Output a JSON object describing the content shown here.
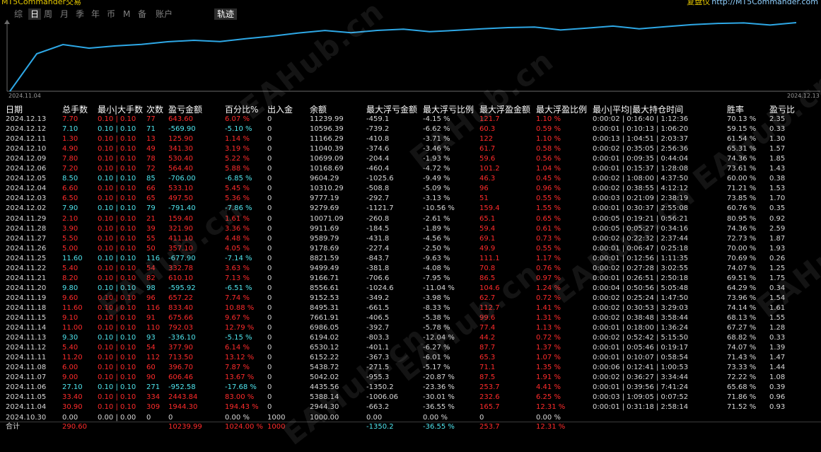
{
  "topbar": {
    "brand": "MT5Commander交易",
    "right_label": "复盘仪",
    "right_url": "http://MT5Commander.com"
  },
  "tabs": [
    "综",
    "日",
    "周",
    "月",
    "季",
    "年",
    "币",
    "M",
    "备",
    "账户"
  ],
  "active_tab": "日",
  "track_tab": "轨迹",
  "chart": {
    "start_date": "2024.11.04",
    "end_date": "2024.12.13",
    "line_color": "#2ea8e6",
    "balance_series": [
      1000.0,
      2944.3,
      5388.14,
      4435.56,
      5042.02,
      5438.72,
      6152.22,
      6530.12,
      6194.02,
      6986.05,
      7661.91,
      8495.31,
      9152.53,
      8556.61,
      9166.71,
      9499.49,
      8821.59,
      9178.69,
      9589.79,
      9911.69,
      10071.09,
      9279.69,
      9777.19,
      10310.29,
      9604.29,
      10168.69,
      10699.09,
      11040.39,
      11166.29,
      10596.39,
      11239.99
    ]
  },
  "columns": [
    "日期",
    "总手数",
    "最小|大手数",
    "次数",
    "盈亏金额",
    "百分比%",
    "出入金",
    "余额",
    "最大浮亏金额",
    "最大浮亏比例",
    "最大浮盈金额",
    "最大浮盈比例",
    "最小|平均|最大持仓时间",
    "胜率",
    "盈亏比"
  ],
  "rows": [
    {
      "c": "red",
      "date": "2024.12.13",
      "lots": "7.70",
      "minmax": "0.10 | 0.10",
      "count": "77",
      "pnl": "643.60",
      "pct": "6.07 %",
      "io": "0",
      "bal": "11239.99",
      "mdd": "-459.1",
      "mddp": "-4.15 %",
      "mfe": "121.7",
      "mfep": "1.10 %",
      "hold": "0:00:02 | 0:16:40 | 1:12:36",
      "win": "70.13 %",
      "pf": "2.35"
    },
    {
      "c": "cyan",
      "date": "2024.12.12",
      "lots": "7.10",
      "minmax": "0.10 | 0.10",
      "count": "71",
      "pnl": "-569.90",
      "pct": "-5.10 %",
      "io": "0",
      "bal": "10596.39",
      "mdd": "-739.2",
      "mddp": "-6.62 %",
      "mfe": "60.3",
      "mfep": "0.59 %",
      "hold": "0:00:01 | 0:10:13 | 1:06:20",
      "win": "59.15 %",
      "pf": "0.33"
    },
    {
      "c": "red",
      "date": "2024.12.11",
      "lots": "1.30",
      "minmax": "0.10 | 0.10",
      "count": "13",
      "pnl": "125.90",
      "pct": "1.14 %",
      "io": "0",
      "bal": "11166.29",
      "mdd": "-410.8",
      "mddp": "-3.71 %",
      "mfe": "122",
      "mfep": "1.10 %",
      "hold": "0:00:13 | 1:04:51 | 2:03:37",
      "win": "61.54 %",
      "pf": "1.30"
    },
    {
      "c": "red",
      "date": "2024.12.10",
      "lots": "4.90",
      "minmax": "0.10 | 0.10",
      "count": "49",
      "pnl": "341.30",
      "pct": "3.19 %",
      "io": "0",
      "bal": "11040.39",
      "mdd": "-374.6",
      "mddp": "-3.46 %",
      "mfe": "61.7",
      "mfep": "0.58 %",
      "hold": "0:00:02 | 0:35:05 | 2:56:36",
      "win": "65.31 %",
      "pf": "1.57"
    },
    {
      "c": "red",
      "date": "2024.12.09",
      "lots": "7.80",
      "minmax": "0.10 | 0.10",
      "count": "78",
      "pnl": "530.40",
      "pct": "5.22 %",
      "io": "0",
      "bal": "10699.09",
      "mdd": "-204.4",
      "mddp": "-1.93 %",
      "mfe": "59.6",
      "mfep": "0.56 %",
      "hold": "0:00:01 | 0:09:35 | 0:44:04",
      "win": "74.36 %",
      "pf": "1.85"
    },
    {
      "c": "red",
      "date": "2024.12.06",
      "lots": "7.20",
      "minmax": "0.10 | 0.10",
      "count": "72",
      "pnl": "564.40",
      "pct": "5.88 %",
      "io": "0",
      "bal": "10168.69",
      "mdd": "-460.4",
      "mddp": "-4.72 %",
      "mfe": "101.2",
      "mfep": "1.04 %",
      "hold": "0:00:01 | 0:15:37 | 1:28:08",
      "win": "73.61 %",
      "pf": "1.43"
    },
    {
      "c": "cyan",
      "date": "2024.12.05",
      "lots": "8.50",
      "minmax": "0.10 | 0.10",
      "count": "85",
      "pnl": "-706.00",
      "pct": "-6.85 %",
      "io": "0",
      "bal": "9604.29",
      "mdd": "-1025.6",
      "mddp": "-9.49 %",
      "mfe": "46.3",
      "mfep": "0.45 %",
      "hold": "0:00:02 | 1:08:00 | 4:37:50",
      "win": "60.00 %",
      "pf": "0.38"
    },
    {
      "c": "red",
      "date": "2024.12.04",
      "lots": "6.60",
      "minmax": "0.10 | 0.10",
      "count": "66",
      "pnl": "533.10",
      "pct": "5.45 %",
      "io": "0",
      "bal": "10310.29",
      "mdd": "-508.8",
      "mddp": "-5.09 %",
      "mfe": "96",
      "mfep": "0.96 %",
      "hold": "0:00:02 | 0:38:55 | 4:12:12",
      "win": "71.21 %",
      "pf": "1.53"
    },
    {
      "c": "red",
      "date": "2024.12.03",
      "lots": "6.50",
      "minmax": "0.10 | 0.10",
      "count": "65",
      "pnl": "497.50",
      "pct": "5.36 %",
      "io": "0",
      "bal": "9777.19",
      "mdd": "-292.7",
      "mddp": "-3.13 %",
      "mfe": "51",
      "mfep": "0.55 %",
      "hold": "0:00:03 | 0:21:09 | 2:38:19",
      "win": "73.85 %",
      "pf": "1.70"
    },
    {
      "c": "cyan",
      "date": "2024.12.02",
      "lots": "7.90",
      "minmax": "0.10 | 0.10",
      "count": "79",
      "pnl": "-791.40",
      "pct": "-7.86 %",
      "io": "0",
      "bal": "9279.69",
      "mdd": "-1121.7",
      "mddp": "-10.56 %",
      "mfe": "159.4",
      "mfep": "1.55 %",
      "hold": "0:00:01 | 0:30:37 | 2:55:08",
      "win": "60.76 %",
      "pf": "0.35"
    },
    {
      "c": "red",
      "date": "2024.11.29",
      "lots": "2.10",
      "minmax": "0.10 | 0.10",
      "count": "21",
      "pnl": "159.40",
      "pct": "1.61 %",
      "io": "0",
      "bal": "10071.09",
      "mdd": "-260.8",
      "mddp": "-2.61 %",
      "mfe": "65.1",
      "mfep": "0.65 %",
      "hold": "0:00:05 | 0:19:21 | 0:56:21",
      "win": "80.95 %",
      "pf": "0.92"
    },
    {
      "c": "red",
      "date": "2024.11.28",
      "lots": "3.90",
      "minmax": "0.10 | 0.10",
      "count": "39",
      "pnl": "321.90",
      "pct": "3.36 %",
      "io": "0",
      "bal": "9911.69",
      "mdd": "-184.5",
      "mddp": "-1.89 %",
      "mfe": "59.4",
      "mfep": "0.61 %",
      "hold": "0:00:05 | 0:05:27 | 0:34:16",
      "win": "74.36 %",
      "pf": "2.59"
    },
    {
      "c": "red",
      "date": "2024.11.27",
      "lots": "5.50",
      "minmax": "0.10 | 0.10",
      "count": "55",
      "pnl": "411.10",
      "pct": "4.48 %",
      "io": "0",
      "bal": "9589.79",
      "mdd": "-431.8",
      "mddp": "-4.56 %",
      "mfe": "69.1",
      "mfep": "0.73 %",
      "hold": "0:00:02 | 0:22:32 | 2:37:44",
      "win": "72.73 %",
      "pf": "1.87"
    },
    {
      "c": "red",
      "date": "2024.11.26",
      "lots": "5.00",
      "minmax": "0.10 | 0.10",
      "count": "50",
      "pnl": "357.10",
      "pct": "4.05 %",
      "io": "0",
      "bal": "9178.69",
      "mdd": "-227.4",
      "mddp": "-2.50 %",
      "mfe": "49.9",
      "mfep": "0.55 %",
      "hold": "0:00:01 | 0:06:47 | 0:25:18",
      "win": "70.00 %",
      "pf": "1.93"
    },
    {
      "c": "cyan",
      "date": "2024.11.25",
      "lots": "11.60",
      "minmax": "0.10 | 0.10",
      "count": "116",
      "pnl": "-677.90",
      "pct": "-7.14 %",
      "io": "0",
      "bal": "8821.59",
      "mdd": "-843.7",
      "mddp": "-9.63 %",
      "mfe": "111.1",
      "mfep": "1.17 %",
      "hold": "0:00:01 | 0:12:56 | 1:11:35",
      "win": "70.69 %",
      "pf": "0.26"
    },
    {
      "c": "red",
      "date": "2024.11.22",
      "lots": "5.40",
      "minmax": "0.10 | 0.10",
      "count": "54",
      "pnl": "332.78",
      "pct": "3.63 %",
      "io": "0",
      "bal": "9499.49",
      "mdd": "-381.8",
      "mddp": "-4.08 %",
      "mfe": "70.8",
      "mfep": "0.76 %",
      "hold": "0:00:02 | 0:27:28 | 3:02:55",
      "win": "74.07 %",
      "pf": "1.25"
    },
    {
      "c": "red",
      "date": "2024.11.21",
      "lots": "8.20",
      "minmax": "0.10 | 0.10",
      "count": "82",
      "pnl": "610.10",
      "pct": "7.13 %",
      "io": "0",
      "bal": "9166.71",
      "mdd": "-706.6",
      "mddp": "-7.95 %",
      "mfe": "86.5",
      "mfep": "0.97 %",
      "hold": "0:00:01 | 0:26:51 | 2:50:18",
      "win": "69.51 %",
      "pf": "1.75"
    },
    {
      "c": "cyan",
      "date": "2024.11.20",
      "lots": "9.80",
      "minmax": "0.10 | 0.10",
      "count": "98",
      "pnl": "-595.92",
      "pct": "-6.51 %",
      "io": "0",
      "bal": "8556.61",
      "mdd": "-1024.6",
      "mddp": "-11.04 %",
      "mfe": "104.6",
      "mfep": "1.24 %",
      "hold": "0:00:04 | 0:50:56 | 5:05:48",
      "win": "64.29 %",
      "pf": "0.34"
    },
    {
      "c": "red",
      "date": "2024.11.19",
      "lots": "9.60",
      "minmax": "0.10 | 0.10",
      "count": "96",
      "pnl": "657.22",
      "pct": "7.74 %",
      "io": "0",
      "bal": "9152.53",
      "mdd": "-349.2",
      "mddp": "-3.98 %",
      "mfe": "62.7",
      "mfep": "0.72 %",
      "hold": "0:00:02 | 0:25:24 | 1:47:50",
      "win": "73.96 %",
      "pf": "1.54"
    },
    {
      "c": "red",
      "date": "2024.11.18",
      "lots": "11.60",
      "minmax": "0.10 | 0.10",
      "count": "116",
      "pnl": "833.40",
      "pct": "10.88 %",
      "io": "0",
      "bal": "8495.31",
      "mdd": "-661.5",
      "mddp": "-8.33 %",
      "mfe": "112.7",
      "mfep": "1.41 %",
      "hold": "0:00:02 | 0:30:53 | 3:29:03",
      "win": "74.14 %",
      "pf": "1.61"
    },
    {
      "c": "red",
      "date": "2024.11.15",
      "lots": "9.10",
      "minmax": "0.10 | 0.10",
      "count": "91",
      "pnl": "675.66",
      "pct": "9.67 %",
      "io": "0",
      "bal": "7661.91",
      "mdd": "-406.5",
      "mddp": "-5.38 %",
      "mfe": "99.6",
      "mfep": "1.31 %",
      "hold": "0:00:02 | 0:38:48 | 3:58:44",
      "win": "68.13 %",
      "pf": "1.55"
    },
    {
      "c": "red",
      "date": "2024.11.14",
      "lots": "11.00",
      "minmax": "0.10 | 0.10",
      "count": "110",
      "pnl": "792.03",
      "pct": "12.79 %",
      "io": "0",
      "bal": "6986.05",
      "mdd": "-392.7",
      "mddp": "-5.78 %",
      "mfe": "77.4",
      "mfep": "1.13 %",
      "hold": "0:00:01 | 0:18:00 | 1:36:24",
      "win": "67.27 %",
      "pf": "1.28"
    },
    {
      "c": "cyan",
      "date": "2024.11.13",
      "lots": "9.30",
      "minmax": "0.10 | 0.10",
      "count": "93",
      "pnl": "-336.10",
      "pct": "-5.15 %",
      "io": "0",
      "bal": "6194.02",
      "mdd": "-803.3",
      "mddp": "-12.04 %",
      "mfe": "44.2",
      "mfep": "0.72 %",
      "hold": "0:00:02 | 0:52:42 | 5:15:50",
      "win": "68.82 %",
      "pf": "0.33"
    },
    {
      "c": "red",
      "date": "2024.11.12",
      "lots": "5.40",
      "minmax": "0.10 | 0.10",
      "count": "54",
      "pnl": "377.90",
      "pct": "6.14 %",
      "io": "0",
      "bal": "6530.12",
      "mdd": "-401.1",
      "mddp": "-6.27 %",
      "mfe": "87.7",
      "mfep": "1.37 %",
      "hold": "0:00:01 | 0:05:46 | 0:19:17",
      "win": "74.07 %",
      "pf": "1.39"
    },
    {
      "c": "red",
      "date": "2024.11.11",
      "lots": "11.20",
      "minmax": "0.10 | 0.10",
      "count": "112",
      "pnl": "713.50",
      "pct": "13.12 %",
      "io": "0",
      "bal": "6152.22",
      "mdd": "-367.3",
      "mddp": "-6.01 %",
      "mfe": "65.3",
      "mfep": "1.07 %",
      "hold": "0:00:01 | 0:10:07 | 0:58:54",
      "win": "71.43 %",
      "pf": "1.47"
    },
    {
      "c": "red",
      "date": "2024.11.08",
      "lots": "6.00",
      "minmax": "0.10 | 0.10",
      "count": "60",
      "pnl": "396.70",
      "pct": "7.87 %",
      "io": "0",
      "bal": "5438.72",
      "mdd": "-271.5",
      "mddp": "-5.17 %",
      "mfe": "71.1",
      "mfep": "1.35 %",
      "hold": "0:00:06 | 0:12:41 | 1:00:53",
      "win": "73.33 %",
      "pf": "1.44"
    },
    {
      "c": "red",
      "date": "2024.11.07",
      "lots": "9.00",
      "minmax": "0.10 | 0.10",
      "count": "90",
      "pnl": "606.46",
      "pct": "13.67 %",
      "io": "0",
      "bal": "5042.02",
      "mdd": "-955.3",
      "mddp": "-20.87 %",
      "mfe": "87.5",
      "mfep": "1.91 %",
      "hold": "0:00:02 | 0:36:27 | 3:34:44",
      "win": "72.22 %",
      "pf": "1.08"
    },
    {
      "c": "cyan",
      "date": "2024.11.06",
      "lots": "27.10",
      "minmax": "0.10 | 0.10",
      "count": "271",
      "pnl": "-952.58",
      "pct": "-17.68 %",
      "io": "0",
      "bal": "4435.56",
      "mdd": "-1350.2",
      "mddp": "-23.36 %",
      "mfe": "253.7",
      "mfep": "4.41 %",
      "hold": "0:00:01 | 0:39:56 | 7:41:24",
      "win": "65.68 %",
      "pf": "0.39"
    },
    {
      "c": "red",
      "date": "2024.11.05",
      "lots": "33.40",
      "minmax": "0.10 | 0.10",
      "count": "334",
      "pnl": "2443.84",
      "pct": "83.00 %",
      "io": "0",
      "bal": "5388.14",
      "mdd": "-1006.06",
      "mddp": "-30.01 %",
      "mfe": "232.6",
      "mfep": "6.25 %",
      "hold": "0:00:03 | 1:09:05 | 0:07:52",
      "win": "71.86 %",
      "pf": "0.96"
    },
    {
      "c": "red",
      "date": "2024.11.04",
      "lots": "30.90",
      "minmax": "0.10 | 0.10",
      "count": "309",
      "pnl": "1944.30",
      "pct": "194.43 %",
      "io": "0",
      "bal": "2944.30",
      "mdd": "-663.2",
      "mddp": "-36.55 %",
      "mfe": "165.7",
      "mfep": "12.31 %",
      "hold": "0:00:01 | 0:31:18 | 2:58:14",
      "win": "71.52 %",
      "pf": "0.93"
    },
    {
      "c": "white",
      "date": "2024.10.30",
      "lots": "0.00",
      "minmax": "0.00 | 0.00",
      "count": "0",
      "pnl": "0",
      "pct": "0.00 %",
      "io": "1000",
      "bal": "1000.00",
      "mdd": "0.00",
      "mddp": "0.00 %",
      "mfe": "0",
      "mfep": "0.00 %",
      "hold": "",
      "win": "",
      "pf": ""
    }
  ],
  "total": {
    "label": "合计",
    "lots": "290.60",
    "pnl": "10239.99",
    "pct": "1024.00 %",
    "io": "1000",
    "mdd": "-1350.2",
    "mddp": "-36.55 %",
    "mfe": "253.7",
    "mfep": "12.31 %"
  },
  "colors": {
    "profit": "#ff2b2b",
    "loss": "#4fe5ee",
    "neutral": "#d8d8d8",
    "line": "#2ea8e6"
  },
  "watermark": "EAHub.cn"
}
